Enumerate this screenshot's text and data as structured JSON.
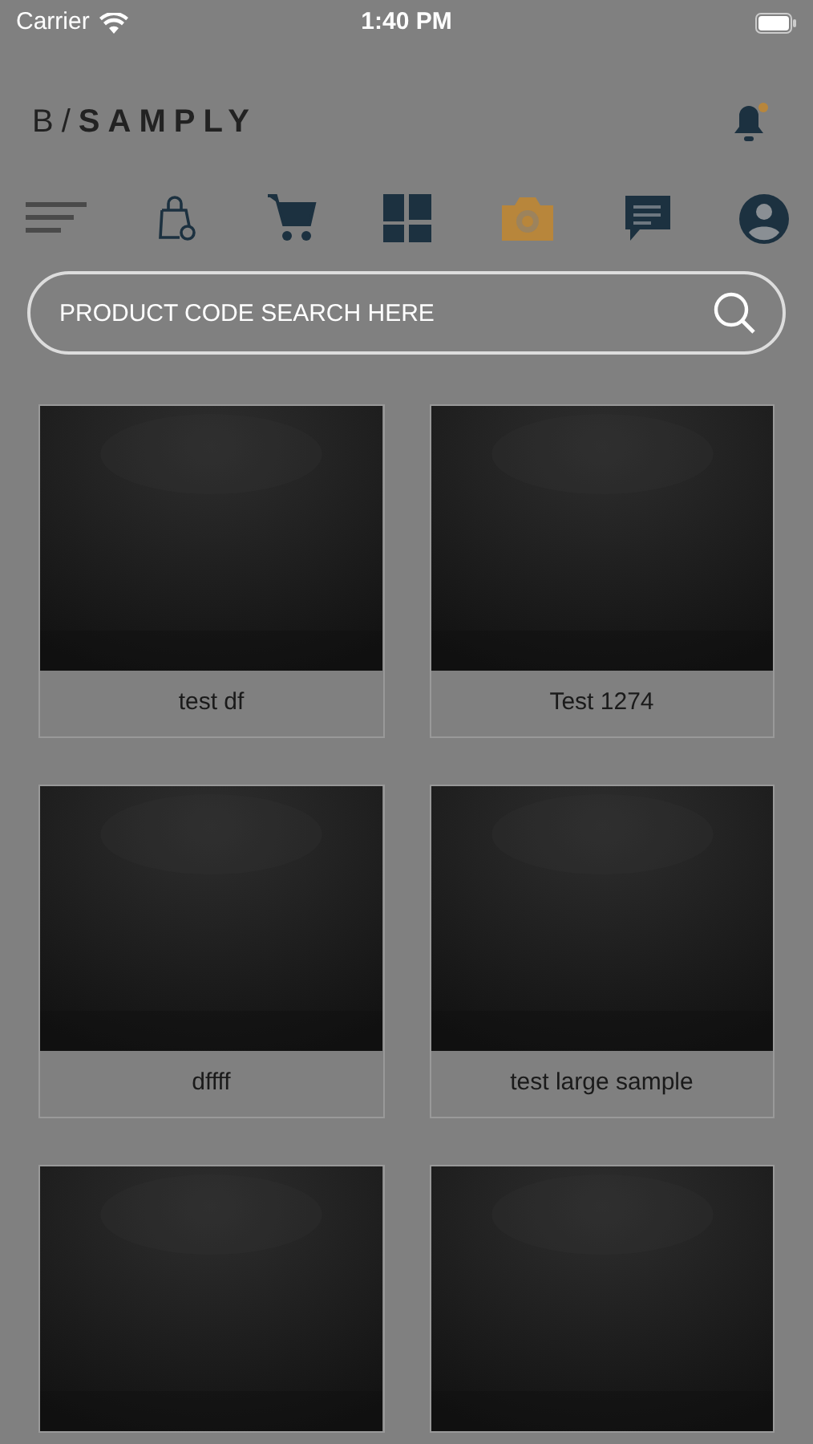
{
  "status_bar": {
    "carrier": "Carrier",
    "time": "1:40 PM"
  },
  "header": {
    "logo": "B/**SAMPLY**",
    "notification_badge": true
  },
  "nav": [
    {
      "kind": "menu",
      "selected": false
    },
    {
      "kind": "bag",
      "selected": false
    },
    {
      "kind": "cart",
      "selected": false
    },
    {
      "kind": "dashboard",
      "selected": false
    },
    {
      "kind": "camera",
      "selected": true
    },
    {
      "kind": "chat",
      "selected": false
    },
    {
      "kind": "account",
      "selected": false
    }
  ],
  "search": {
    "placeholder": "PRODUCT CODE SEARCH HERE"
  },
  "products": [
    {
      "kind": "labeled",
      "name": "test df"
    },
    {
      "kind": "labeled",
      "name": "Test 1274"
    },
    {
      "kind": "labeled",
      "name": "dffff"
    },
    {
      "kind": "labeled",
      "name": "test large sample"
    },
    {
      "kind": "image_only"
    },
    {
      "kind": "image_only"
    }
  ]
}
